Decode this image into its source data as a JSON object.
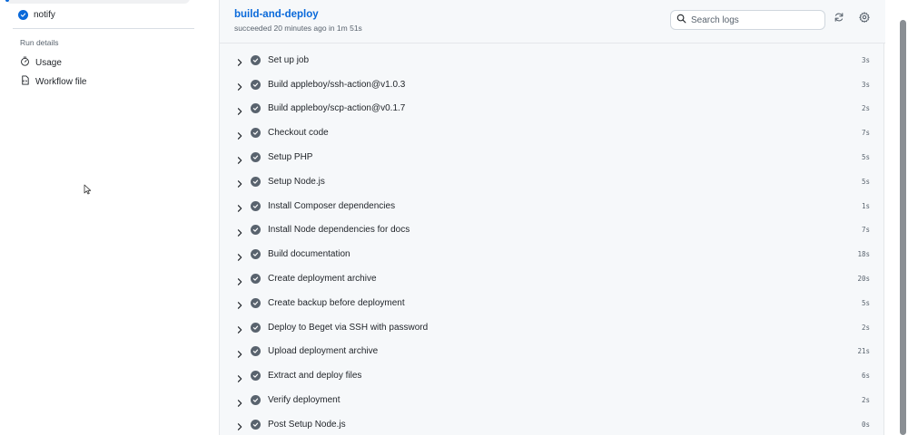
{
  "sidebar": {
    "job_label": "notify",
    "run_details_heading": "Run details",
    "links": [
      {
        "label": "Usage",
        "icon": "stopwatch-icon"
      },
      {
        "label": "Workflow file",
        "icon": "file-code-icon"
      }
    ]
  },
  "job": {
    "title": "build-and-deploy",
    "subtitle": "succeeded 20 minutes ago in 1m 51s"
  },
  "search": {
    "placeholder": "Search logs"
  },
  "steps": [
    {
      "name": "Set up job",
      "duration": "3s"
    },
    {
      "name": "Build appleboy/ssh-action@v1.0.3",
      "duration": "3s"
    },
    {
      "name": "Build appleboy/scp-action@v0.1.7",
      "duration": "2s"
    },
    {
      "name": "Checkout code",
      "duration": "7s"
    },
    {
      "name": "Setup PHP",
      "duration": "5s"
    },
    {
      "name": "Setup Node.js",
      "duration": "5s"
    },
    {
      "name": "Install Composer dependencies",
      "duration": "1s"
    },
    {
      "name": "Install Node dependencies for docs",
      "duration": "7s"
    },
    {
      "name": "Build documentation",
      "duration": "18s"
    },
    {
      "name": "Create deployment archive",
      "duration": "20s"
    },
    {
      "name": "Create backup before deployment",
      "duration": "5s"
    },
    {
      "name": "Deploy to Beget via SSH with password",
      "duration": "2s"
    },
    {
      "name": "Upload deployment archive",
      "duration": "21s"
    },
    {
      "name": "Extract and deploy files",
      "duration": "6s"
    },
    {
      "name": "Verify deployment",
      "duration": "2s"
    },
    {
      "name": "Post Setup Node.js",
      "duration": "0s"
    }
  ],
  "colors": {
    "accent": "#0969da",
    "success_icon": "#59636e",
    "panel_bg": "#f6f8fa"
  }
}
